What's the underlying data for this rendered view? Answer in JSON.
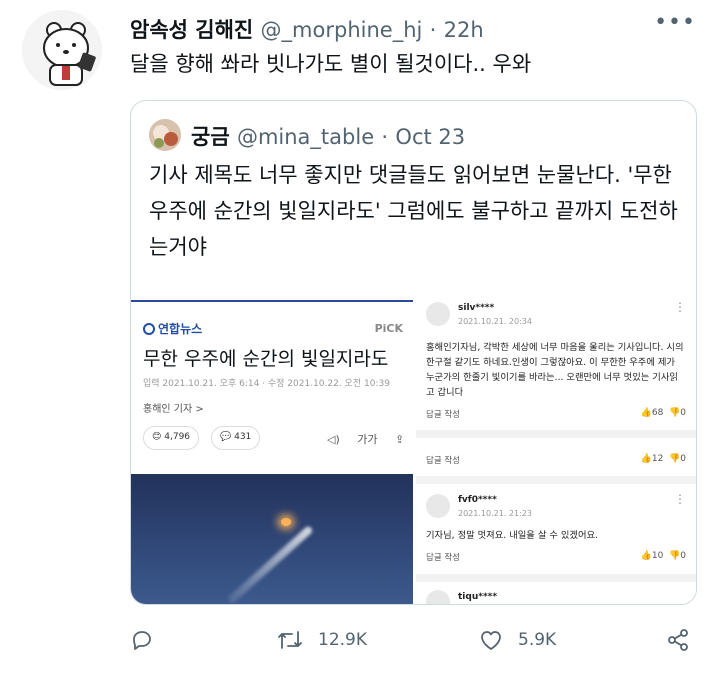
{
  "tweet": {
    "author_name": "암속성 김해진",
    "handle": "@_morphine_hj",
    "separator": "·",
    "time": "22h",
    "more_label": "•••",
    "text": "달을 향해 쏴라 빗나가도 별이 될것이다.. 우와"
  },
  "quote": {
    "author_name": "궁금",
    "handle": "@mina_table",
    "separator": "·",
    "time": "Oct 23",
    "text": "기사 제목도 너무 좋지만 댓글들도 읽어보면 눈물난다. '무한 우주에 순간의 빛일지라도' 그럼에도 불구하고 끝까지 도전하는거야"
  },
  "article": {
    "source": "연합뉴스",
    "pick_label": "PiCK",
    "title": "무한 우주에 순간의 빛일지라도",
    "meta": "입력 2021.10.21. 오후 6:14 · 수정 2021.10.22. 오전 10:39",
    "reporter": "홍해인 기자 >",
    "reactions_count": "4,796",
    "comments_count": "431",
    "icons_text": "◁) 가가 ⇪"
  },
  "comments": [
    {
      "user": "silv****",
      "date": "2021.10.21. 20:34",
      "body": "홍해인기자님, 각박한 세상에 너무 마음을 울리는 기사입니다. 시의 한구절 같기도 하네요.인생이 그렇잖아요. 이 무한한 우주에 제가 누군가의 한줄기 빛이기를 바라는... 오랜만에 너무 멋있는 기사읽고 갑니다",
      "reply": "답글 작성",
      "likes": "68",
      "dislikes": "0"
    },
    {
      "user": "",
      "date": "",
      "body": "",
      "reply": "답글 작성",
      "likes": "12",
      "dislikes": "0"
    },
    {
      "user": "fvf0****",
      "date": "2021.10.21. 21:23",
      "body": "기자님, 정말 멋져요. 내일을 살 수 있겠어요.",
      "reply": "답글 작성",
      "likes": "10",
      "dislikes": "0"
    },
    {
      "user": "tiqu****",
      "date": "",
      "body": "",
      "reply": "",
      "likes": "",
      "dislikes": ""
    }
  ],
  "actions": {
    "reply_count": "",
    "retweet_count": "12.9K",
    "like_count": "5.9K"
  },
  "colors": {
    "text": "#0f1419",
    "muted": "#536471",
    "border": "#cfd9de",
    "yonhap_blue": "#1f4ea3"
  },
  "icons": [
    "reply-icon",
    "retweet-icon",
    "like-icon",
    "share-icon",
    "more-icon"
  ]
}
